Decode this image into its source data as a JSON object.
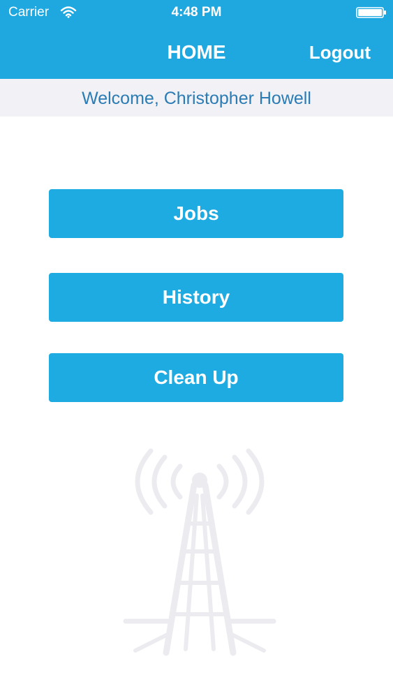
{
  "status_bar": {
    "carrier": "Carrier",
    "time": "4:48 PM",
    "wifi_icon": "wifi-icon",
    "battery_icon": "battery-icon"
  },
  "nav": {
    "title": "HOME",
    "logout_label": "Logout"
  },
  "welcome": {
    "text": "Welcome, Christopher Howell"
  },
  "menu": {
    "jobs_label": "Jobs",
    "history_label": "History",
    "cleanup_label": "Clean Up"
  },
  "background": {
    "icon": "radio-tower-icon"
  },
  "colors": {
    "header_bg": "#1fa8e0",
    "button_bg": "#1eabe2",
    "welcome_bg": "#f2f2f6",
    "welcome_text": "#2b7bb4",
    "tower_color": "#ececf0"
  }
}
